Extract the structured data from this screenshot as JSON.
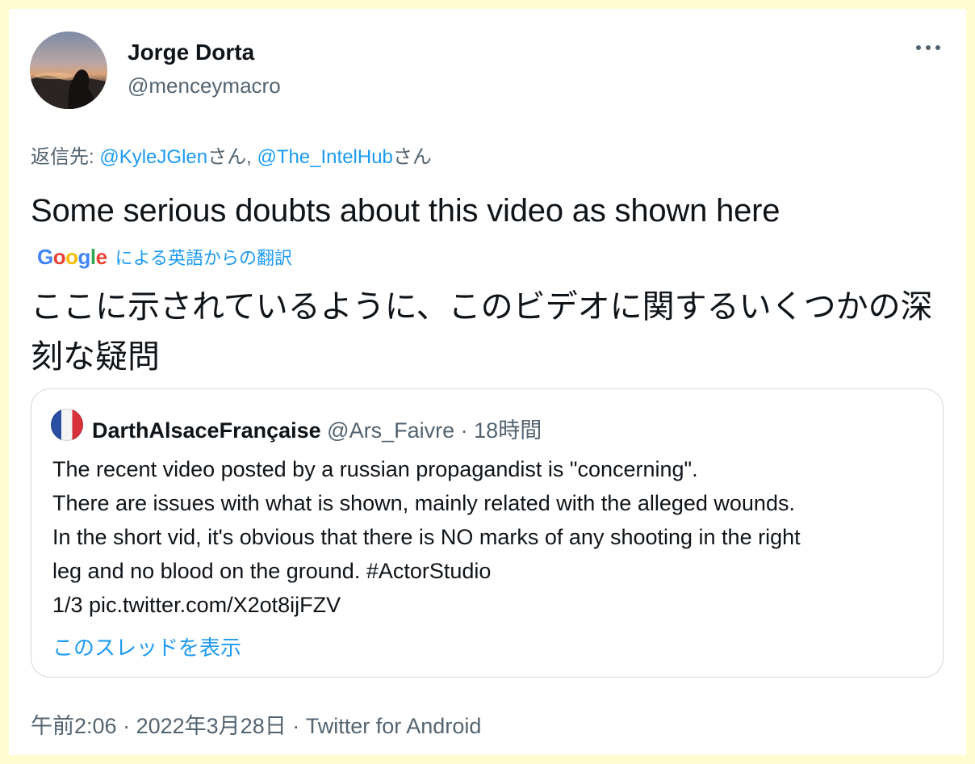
{
  "author": {
    "display_name": "Jorge Dorta",
    "handle": "@menceymacro"
  },
  "more_icon": "more-horizontal-icon",
  "reply": {
    "prefix": "返信先: ",
    "mention1": "@KyleJGlen",
    "suffix1": "さん, ",
    "mention2": "@The_IntelHub",
    "suffix2": "さん"
  },
  "tweet_text": "Some serious doubts about this video as shown here",
  "translation": {
    "google_letters": [
      "G",
      "o",
      "o",
      "g",
      "l",
      "e"
    ],
    "google_colors": [
      "#4285F4",
      "#EA4335",
      "#FBBC05",
      "#4285F4",
      "#34A853",
      "#EA4335"
    ],
    "label": "による英語からの翻訳",
    "text": "ここに示されているように、このビデオに関するいくつかの深刻な疑問"
  },
  "quoted": {
    "display_name": "DarthAlsaceFrançaise",
    "handle": "@Ars_Faivre",
    "separator": "·",
    "time": "18時間",
    "lines": [
      "The recent video posted by a russian propagandist is \"concerning\".",
      "There are issues with what is shown, mainly related with the alleged wounds.",
      "In the short vid, it's obvious that there is NO marks of any shooting in the right",
      "leg and no blood on the ground. #ActorStudio",
      "1/3 pic.twitter.com/X2ot8ijFZV"
    ],
    "show_thread": "このスレッドを表示"
  },
  "meta": {
    "time": "午前2:06",
    "date": "2022年3月28日",
    "source": "Twitter for Android",
    "separator": "·"
  },
  "colors": {
    "page_background": "#fffdd0",
    "link": "#1d9bf0",
    "secondary_text": "#536471",
    "border": "#cfd9de"
  }
}
